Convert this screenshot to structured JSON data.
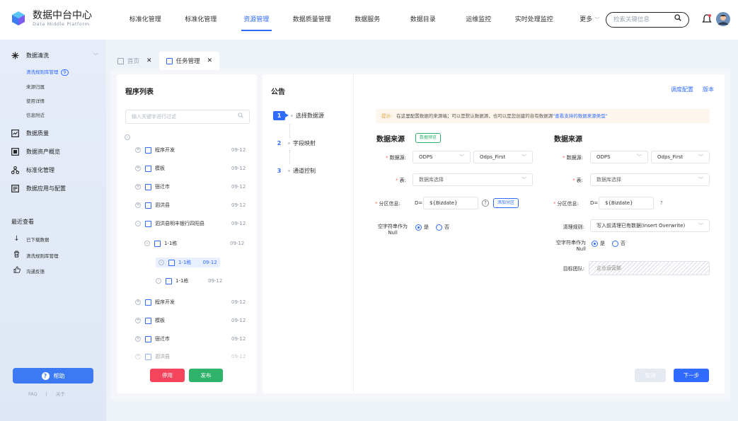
{
  "brand": {
    "title": "数据中台中心",
    "subtitle": "Data Middle Platform"
  },
  "nav": {
    "items": [
      "标准化管理",
      "标准化管理",
      "资源管理",
      "数据质量管理",
      "数据服务",
      "数据目录",
      "运维监控",
      "实时处理监控",
      "更多"
    ],
    "active_index": 2,
    "more_chevron": "﹀"
  },
  "search": {
    "placeholder": "检索关键信息"
  },
  "sidebar": {
    "groups": [
      {
        "label": "数据清洗",
        "icon": "data-clean-icon",
        "chevron": "﹀"
      },
      {
        "label": "数据质量",
        "icon": "data-quality-icon"
      },
      {
        "label": "数据资产概览",
        "icon": "asset-overview-icon"
      },
      {
        "label": "标准化管理",
        "icon": "standardize-icon"
      },
      {
        "label": "数据应用与配置",
        "icon": "app-config-icon"
      }
    ],
    "subitems": [
      {
        "label": "清洗规则库管理",
        "badge": "9",
        "active": true
      },
      {
        "label": "来源归属"
      },
      {
        "label": "使用详情"
      },
      {
        "label": "信息附近"
      }
    ],
    "recent_title": "最近查看",
    "recent": [
      {
        "label": "已下载数据",
        "icon": "download-icon"
      },
      {
        "label": "清洗规则库管理",
        "icon": "trash-icon"
      },
      {
        "label": "沟通反馈",
        "icon": "thumbs-up-icon"
      }
    ],
    "help_label": "帮助",
    "footer_faq": "FAQ",
    "footer_sep": "|",
    "footer_about": "关于"
  },
  "tabs": [
    {
      "label": "首页",
      "close": "✕"
    },
    {
      "label": "任务管理",
      "close": "✕"
    }
  ],
  "program_panel": {
    "title": "程序列表",
    "filter_placeholder": "输入关键字进行过滤",
    "tree": [
      {
        "label": "",
        "date": "",
        "expand": "-"
      },
      {
        "label": "程序开发",
        "date": "09-12",
        "expand": "+"
      },
      {
        "label": "模板",
        "date": "09-12",
        "expand": "+"
      },
      {
        "label": "宿迁市",
        "date": "09-12",
        "expand": "+"
      },
      {
        "label": "泗洪县",
        "date": "09-12",
        "expand": "+"
      },
      {
        "label": "泗洪县明丰银行四阳县",
        "date": "09-12",
        "expand": "-"
      },
      {
        "label": "1-1栋",
        "date": "09-12",
        "expand": "-"
      },
      {
        "label": "1-1栋",
        "date": "09-12",
        "expand": "-",
        "selected": true
      },
      {
        "label": "1-1栋",
        "date": "09-12",
        "expand": "-"
      },
      {
        "label": "程序开发",
        "date": "09-12",
        "expand": "+"
      },
      {
        "label": "模板",
        "date": "09-12",
        "expand": "+"
      },
      {
        "label": "宿迁市",
        "date": "09-12",
        "expand": "+"
      },
      {
        "label": "泗洪县",
        "date": "09-12",
        "expand": "+"
      }
    ],
    "disable_label": "停用",
    "publish_label": "发布"
  },
  "main_panel": {
    "title": "公告",
    "link_schedule": "调度配置",
    "link_version": "版本",
    "steps": [
      {
        "num": "1",
        "label": "选择数据源"
      },
      {
        "num": "2",
        "label": "字段映射"
      },
      {
        "num": "3",
        "label": "通道控制"
      }
    ],
    "tip_label": "提示:",
    "tip_text": "在这里配置数据的来源端；可以是默认数据源，也可以是您创建的自有数据源",
    "tip_link": "\"查看支持的数据来源类型\"",
    "left": {
      "title": "数据来源",
      "preview_tag": "数据预览",
      "datasource_label": "数据源:",
      "datasource_type": "ODPS",
      "datasource_name": "Odps_First",
      "table_label": "表:",
      "table_placeholder": "数据库选择",
      "partition_label": "分区信息:",
      "partition_prefix": "D=",
      "partition_value": "${Bizdate}",
      "help_mark": "?",
      "add_partition": "添加分区",
      "null_label": "空字符串作为Null",
      "yes": "是",
      "no": "否"
    },
    "right": {
      "title": "数据来源",
      "datasource_label": "数据源:",
      "datasource_type": "ODPS",
      "datasource_name": "Odps_First",
      "table_label": "表:",
      "table_placeholder": "数据库选择",
      "partition_label": "分区信息:",
      "partition_prefix": "D=",
      "partition_value": "${Bizdate}",
      "help_mark": "?",
      "clean_label": "清理规则:",
      "clean_value": "写入前清理已有数据(Insert Overwrite)",
      "null_label": "空字符串作为Null",
      "yes": "是",
      "no": "否",
      "team_label": "目标团队:",
      "team_value": "企业运营部"
    },
    "cancel_label": "取消",
    "next_label": "下一步"
  },
  "colors": {
    "primary": "#2f6bff",
    "danger": "#f5455c",
    "success": "#2fb36b",
    "warning": "#e6a23c"
  }
}
